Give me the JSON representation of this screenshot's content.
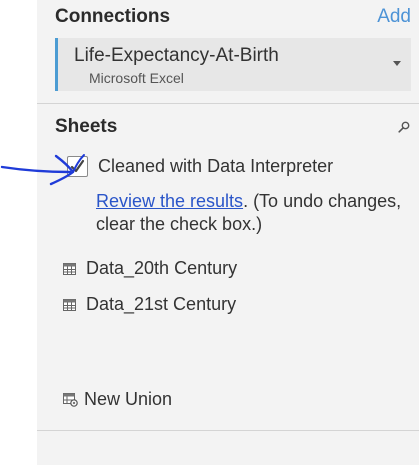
{
  "connections": {
    "title": "Connections",
    "add_label": "Add",
    "items": [
      {
        "name": "Life-Expectancy-At-Birth",
        "type": "Microsoft Excel"
      }
    ]
  },
  "sheets": {
    "title": "Sheets",
    "interpreter": {
      "checked": true,
      "label": "Cleaned with Data Interpreter",
      "review_link": "Review the results",
      "review_suffix": ". (To undo changes, clear the check box.)"
    },
    "items": [
      {
        "label": "Data_20th Century",
        "icon": "table-icon"
      },
      {
        "label": "Data_21st Century",
        "icon": "table-icon"
      }
    ],
    "new_union": {
      "label": "New Union",
      "icon": "union-icon"
    }
  },
  "colors": {
    "accent_blue": "#4c9cd3",
    "link_blue": "#2a55c9",
    "annotation_blue": "#1f3bd8",
    "panel_bg": "#f3f3f3"
  }
}
